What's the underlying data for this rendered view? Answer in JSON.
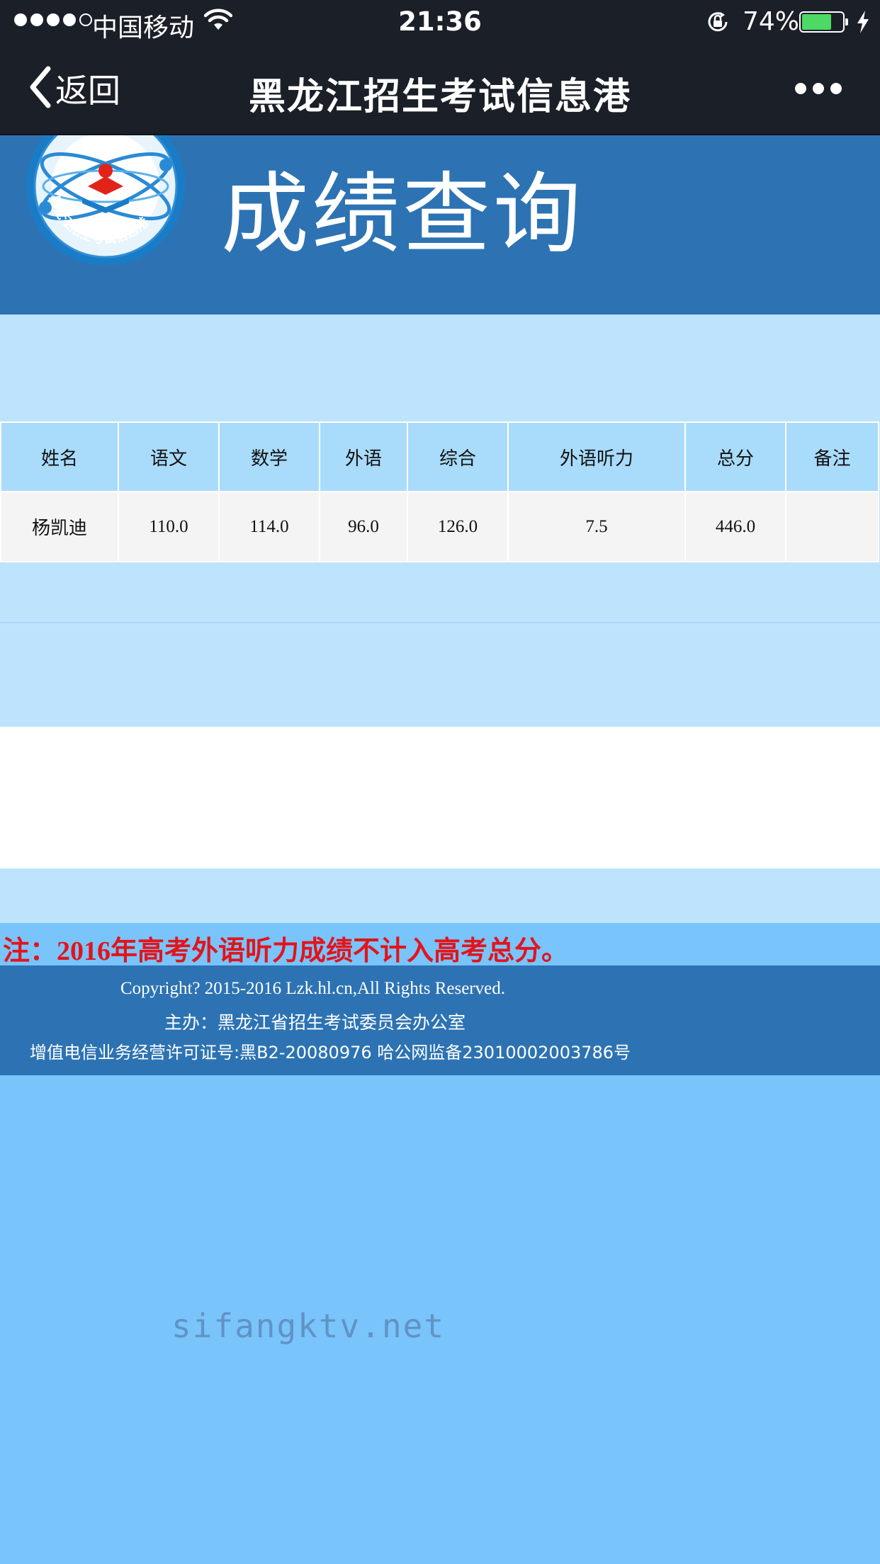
{
  "status_bar": {
    "carrier": "中国移动",
    "time": "21:36",
    "battery_percent": "74%",
    "battery_level": 0.74,
    "signal_bars_filled": 4,
    "signal_bars_total": 5
  },
  "nav": {
    "back_label": "返回",
    "title": "黑龙江招生考试信息港"
  },
  "banner": {
    "logo_text": "黑龙江招生考试信息港",
    "heading": "成绩查询"
  },
  "table": {
    "headers": [
      "姓名",
      "语文",
      "数学",
      "外语",
      "综合",
      "外语听力",
      "总分",
      "备注"
    ],
    "row": {
      "name": "杨凯迪",
      "chinese": "110.0",
      "math": "114.0",
      "foreign_language": "96.0",
      "comprehensive": "126.0",
      "listening": "7.5",
      "total": "446.0",
      "remark": ""
    }
  },
  "note": "注：2016年高考外语听力成绩不计入高考总分。",
  "footer": {
    "copyright": "Copyright? 2015-2016 Lzk.hl.cn,All Rights Reserved.",
    "sponsor": "主办：黑龙江省招生考试委员会办公室",
    "license": "增值电信业务经营许可证号:黑B2-20080976 哈公网监备23010002003786号"
  },
  "watermark": "sifangktv.net",
  "colors": {
    "nav_bg": "#1b1f28",
    "banner_bg": "#2d73b3",
    "panel_bg": "#bee3fd",
    "page_bg": "#79c4fb",
    "note_red": "#e3141b"
  }
}
